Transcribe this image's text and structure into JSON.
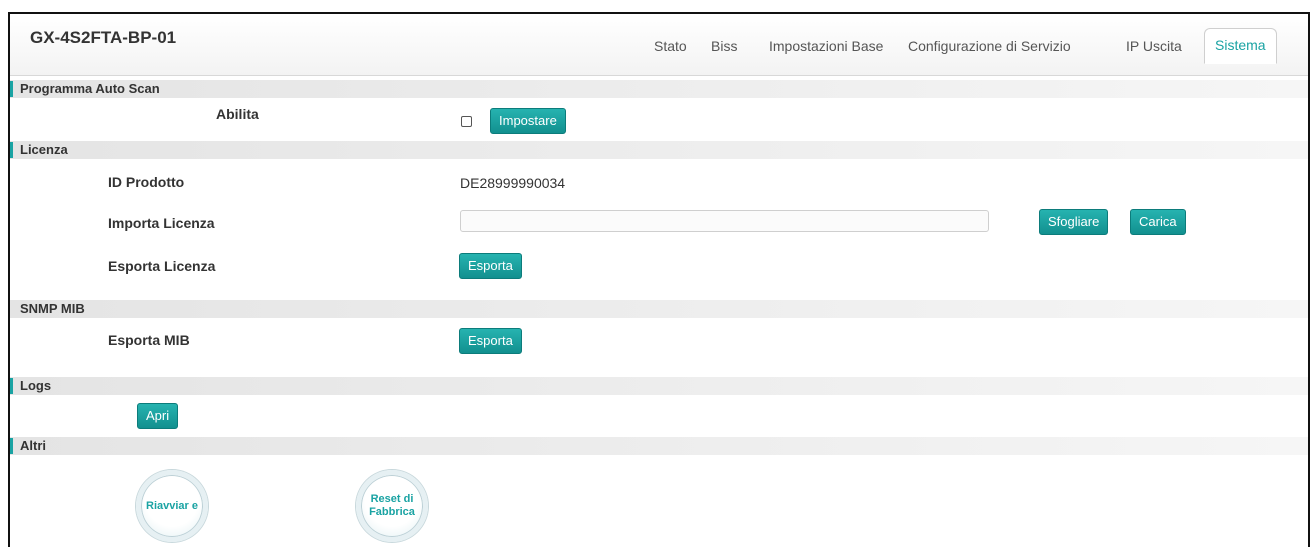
{
  "header": {
    "title": "GX-4S2FTA-BP-01",
    "tabs": [
      {
        "label": "Stato",
        "active": false
      },
      {
        "label": "Biss",
        "active": false
      },
      {
        "label": "Impostazioni Base",
        "active": false
      },
      {
        "label": "Configurazione di Servizio",
        "active": false
      },
      {
        "label": "IP Uscita",
        "active": false
      },
      {
        "label": "Sistema",
        "active": true
      }
    ]
  },
  "auto_scan": {
    "title": "Programma Auto Scan",
    "enable_label": "Abilita",
    "enabled": false,
    "set_button": "Impostare"
  },
  "license": {
    "title": "Licenza",
    "product_id_label": "ID Prodotto",
    "product_id_value": "DE28999990034",
    "import_label": "Importa Licenza",
    "import_value": "",
    "browse_button": "Sfogliare",
    "upload_button": "Carica",
    "export_label": "Esporta Licenza",
    "export_button": "Esporta"
  },
  "snmp": {
    "title": "SNMP MIB",
    "export_label": "Esporta MIB",
    "export_button": "Esporta"
  },
  "logs": {
    "title": "Logs",
    "open_button": "Apri"
  },
  "others": {
    "title": "Altri",
    "restart_button": "Riavviar e",
    "factory_reset_button": "Reset di Fabbrica"
  },
  "colors": {
    "accent": "#1aa3a3",
    "button": "#17a09e",
    "section_bg": "#e4e4e4"
  }
}
